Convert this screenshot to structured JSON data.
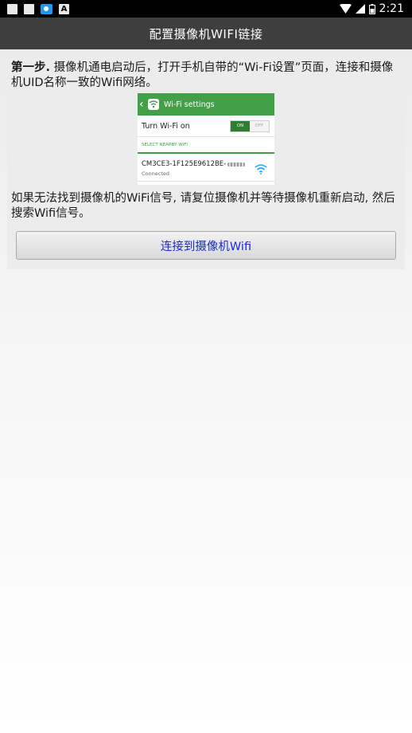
{
  "status_bar": {
    "time": "2:21",
    "left_icons": [
      "notification-icon",
      "notification-icon",
      "camera-app-icon",
      "letter-a-icon"
    ],
    "right_icons": [
      "wifi-signal-icon",
      "cell-signal-icon",
      "battery-icon"
    ]
  },
  "header": {
    "title": "配置摄像机WIFI链接"
  },
  "step": {
    "label": "第一步.",
    "text": " 摄像机通电启动后，打开手机自带的“Wi-Fi设置”页面，连接和摄像机UID名称一致的Wifi网络。"
  },
  "wifi_screenshot": {
    "title": "Wi-Fi settings",
    "row_label": "Turn Wi-Fi on",
    "toggle_on": "ON",
    "toggle_off": "OFF",
    "section_label": "SELECT NEARBY WIFI",
    "network_name": "CM3CE3-1F125E9612BE-",
    "network_status": "Connected"
  },
  "hint": {
    "text": "如果无法找到摄像机的WiFi信号, 请复位摄像机并等待摄像机重新启动, 然后搜索Wifi信号。"
  },
  "connect_button": {
    "label": "连接到摄像机Wifi"
  },
  "colors": {
    "title_bar": "#3e3e3e",
    "wifi_header_green": "#43a047",
    "button_text": "#1a2bd6"
  }
}
